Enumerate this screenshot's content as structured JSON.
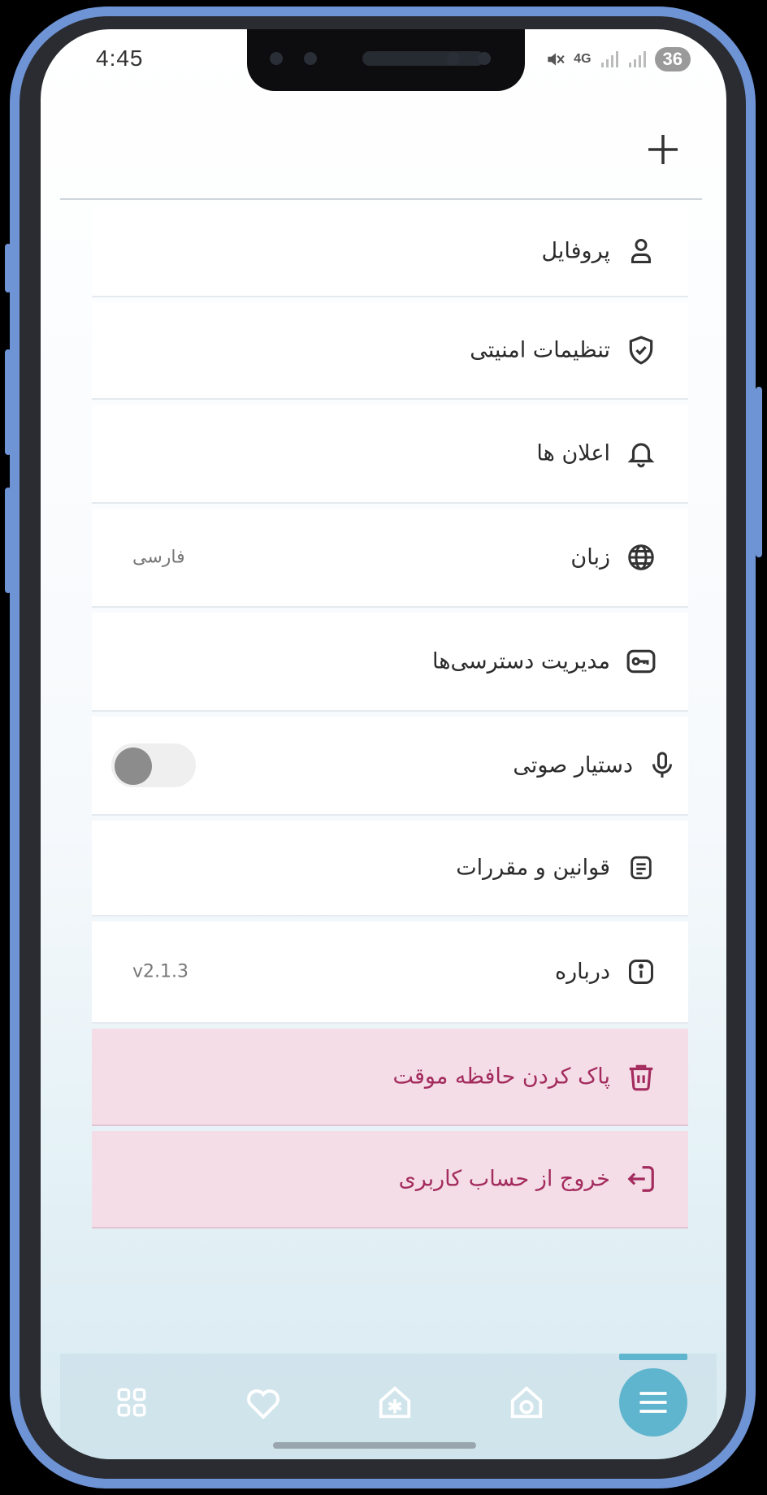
{
  "status_bar": {
    "time": "4:45",
    "network": "4G",
    "battery": "36"
  },
  "header": {
    "add_icon": "plus-icon"
  },
  "settings": {
    "items": [
      {
        "label": "پروفایل",
        "icon": "user-icon",
        "value": ""
      },
      {
        "label": "تنظیمات امنیتی",
        "icon": "shield-check-icon",
        "value": ""
      },
      {
        "label": "اعلان ها",
        "icon": "bell-icon",
        "value": ""
      },
      {
        "label": "زبان",
        "icon": "globe-icon",
        "value": "فارسی"
      },
      {
        "label": "مدیریت دسترسی‌ها",
        "icon": "key-icon",
        "value": ""
      },
      {
        "label": "دستیار صوتی",
        "icon": "microphone-icon",
        "toggle_on": false
      },
      {
        "label": "قوانین و مقررات",
        "icon": "document-icon",
        "value": ""
      },
      {
        "label": "درباره",
        "icon": "info-icon",
        "value": "v2.1.3"
      },
      {
        "label": "پاک کردن حافظه موقت",
        "icon": "trash-icon",
        "danger": true
      },
      {
        "label": "خروج از حساب کاربری",
        "icon": "logout-icon",
        "danger": true
      }
    ]
  },
  "bottom_nav": {
    "items": [
      "grid-icon",
      "heart-icon",
      "home-snowflake-icon",
      "home-dial-icon",
      "menu-icon"
    ],
    "active": "menu-icon"
  },
  "colors": {
    "accent": "#5fb5ce",
    "danger_bg": "#f4dde6",
    "danger_text": "#a32b5e"
  }
}
